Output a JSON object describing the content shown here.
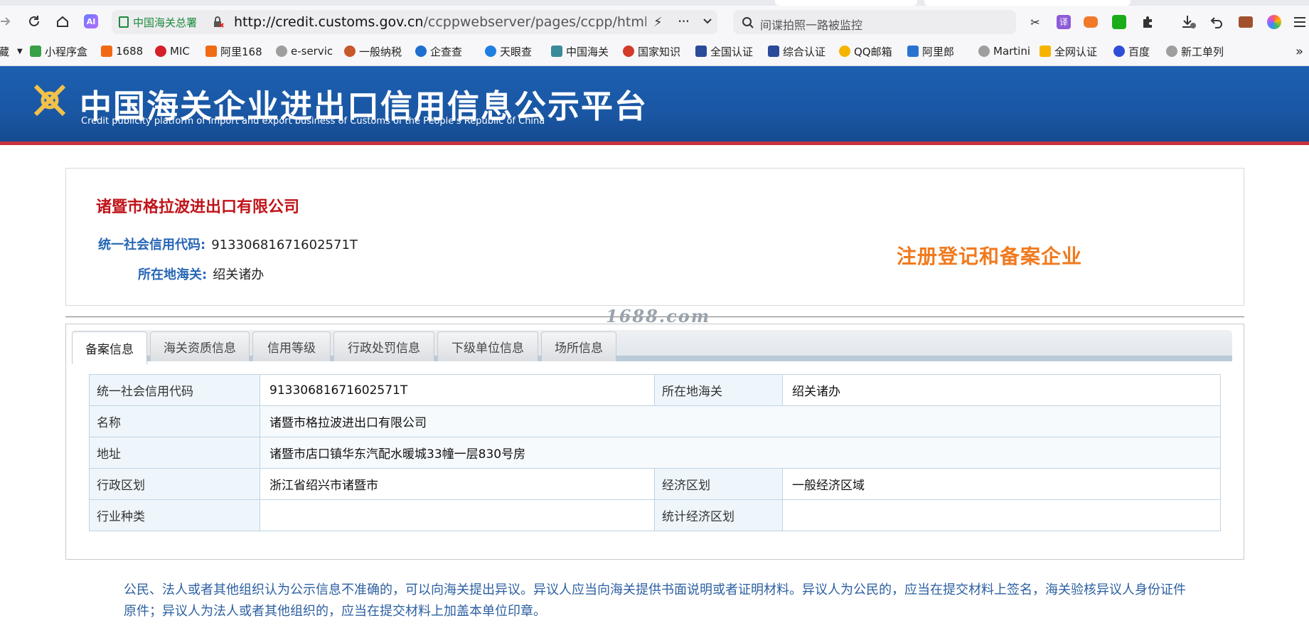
{
  "browser": {
    "site_label": "中国海关总署",
    "url_host": "http://credit.customs.gov.cn",
    "url_path": "/ccppwebserver/pages/ccpp/html/detai",
    "search_placeholder": "间谍拍照一路被监控"
  },
  "bookmarks": [
    {
      "label": "藏",
      "color": "#999999"
    },
    {
      "label": "小程序盒",
      "color": "#3aa046"
    },
    {
      "label": "1688",
      "color": "#f06a14"
    },
    {
      "label": "MIC",
      "color": "#d4202a"
    },
    {
      "label": "阿里168",
      "color": "#f06a14"
    },
    {
      "label": "e-servic",
      "color": "#9e9e9e"
    },
    {
      "label": "一般纳税",
      "color": "#c8582a"
    },
    {
      "label": "企查查",
      "color": "#1e6fd0"
    },
    {
      "label": "天眼查",
      "color": "#1e7fe0"
    },
    {
      "label": "中国海关",
      "color": "#3a8a9a"
    },
    {
      "label": "国家知识",
      "color": "#d33a2a"
    },
    {
      "label": "全国认证",
      "color": "#2a4a9a"
    },
    {
      "label": "综合认证",
      "color": "#2a4a9a"
    },
    {
      "label": "QQ邮箱",
      "color": "#f5b400"
    },
    {
      "label": "阿里郎",
      "color": "#2a72d0"
    },
    {
      "label": "Martini",
      "color": "#9e9e9e"
    },
    {
      "label": "全网认证",
      "color": "#f5b400"
    },
    {
      "label": "百度",
      "color": "#2e4ed8"
    },
    {
      "label": "新工单列",
      "color": "#9e9e9e"
    }
  ],
  "banner": {
    "title_cn": "中国海关企业进出口信用信息公示平台",
    "title_en": "Credit publicity platform of import and export business of Customs of the People's Republic of China"
  },
  "company": {
    "name": "诸暨市格拉波进出口有限公司",
    "credit_code_label": "统一社会信用代码:",
    "credit_code": "91330681671602571T",
    "customs_label": "所在地海关:",
    "customs": "绍关诸办",
    "status_stamp": "注册登记和备案企业"
  },
  "watermark": "1688.com",
  "tabs": [
    {
      "label": "备案信息",
      "active": true
    },
    {
      "label": "海关资质信息",
      "active": false
    },
    {
      "label": "信用等级",
      "active": false
    },
    {
      "label": "行政处罚信息",
      "active": false
    },
    {
      "label": "下级单位信息",
      "active": false
    },
    {
      "label": "场所信息",
      "active": false
    }
  ],
  "table": {
    "credit_code_label": "统一社会信用代码",
    "credit_code": "91330681671602571T",
    "customs_label": "所在地海关",
    "customs": "绍关诸办",
    "name_label": "名称",
    "name": "诸暨市格拉波进出口有限公司",
    "address_label": "地址",
    "address": "诸暨市店口镇华东汽配水暖城33幢一层830号房",
    "admin_region_label": "行政区划",
    "admin_region": "浙江省绍兴市诸暨市",
    "econ_region_label": "经济区划",
    "econ_region": "一般经济区域",
    "industry_label": "行业种类",
    "industry": "",
    "stat_region_label": "统计经济区划",
    "stat_region": ""
  },
  "notice": "公民、法人或者其他组织认为公示信息不准确的，可以向海关提出异议。异议人应当向海关提供书面说明或者证明材料。异议人为公民的，应当在提交材料上签名，海关验核异议人身份证件原件；异议人为法人或者其他组织的，应当在提交材料上加盖本单位印章。"
}
